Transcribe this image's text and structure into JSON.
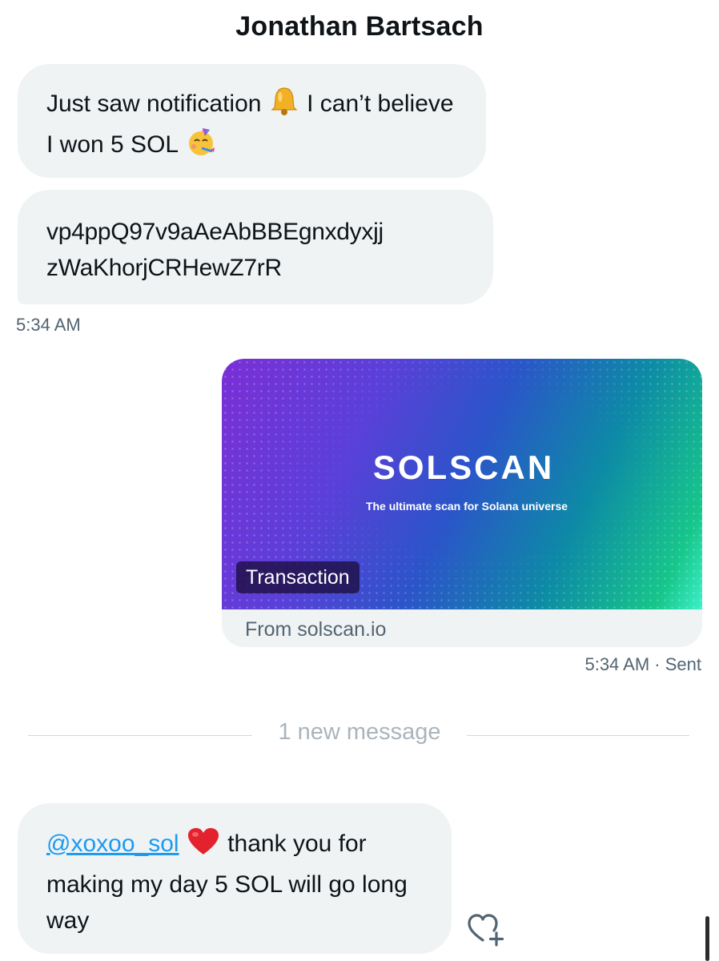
{
  "header": {
    "title": "Jonathan Bartsach"
  },
  "messages": {
    "m1": {
      "text_before": "Just saw notification ",
      "text_middle": " I can’t believe I won 5 SOL ",
      "emoji_1": "bell-emoji",
      "emoji_2": "partying-face-emoji"
    },
    "m2": {
      "line1": "vp4ppQ97v9aAeAbBBEgnxdyxjj",
      "line2": "zWaKhorjCRHewZ7rR"
    },
    "m2_time": "5:34 AM",
    "card": {
      "brand": "SOLSCAN",
      "tagline": "The ultimate scan for Solana universe",
      "badge": "Transaction",
      "source": "From solscan.io"
    },
    "card_time": "5:34 AM · Sent",
    "divider": "1 new message",
    "m3": {
      "mention": "@xoxoo_sol",
      "emoji": "red-heart-emoji",
      "text": " thank you for making my day 5 SOL will go long way"
    }
  },
  "colors": {
    "bubble": "#eff3f4",
    "mention": "#1d9bf0",
    "muted": "#536471",
    "divider_text": "#aab4bc"
  },
  "icons": {
    "react": "heart-plus-icon"
  }
}
